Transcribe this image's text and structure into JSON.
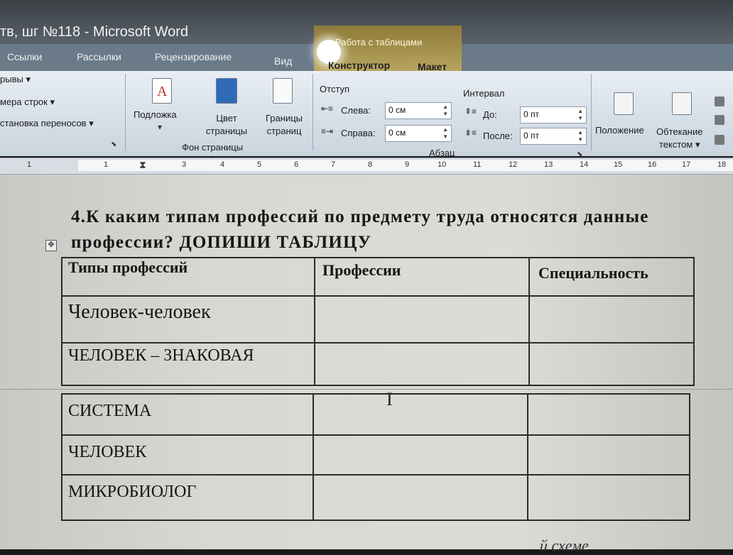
{
  "window": {
    "title": "тв, шг №118  -  Microsoft Word"
  },
  "context_group": {
    "title": "Работа с таблицами",
    "tabs": [
      "Конструктор",
      "Макет"
    ]
  },
  "tabs": [
    "Ссылки",
    "Рассылки",
    "Рецензирование",
    "Вид"
  ],
  "ribbon": {
    "left_items": [
      "рывы",
      "мера строк",
      "становка переносов"
    ],
    "background": {
      "watermark": "Подложка",
      "page_color": "Цвет страницы",
      "page_borders": "Границы страниц",
      "group": "Фон страницы"
    },
    "paragraph": {
      "indent_label": "Отступ",
      "left_label": "Слева:",
      "left_value": "0 см",
      "right_label": "Справа:",
      "right_value": "0 см",
      "spacing_label": "Интервал",
      "before_label": "До:",
      "before_value": "0 пт",
      "after_label": "После:",
      "after_value": "0 пт",
      "group": "Абзац"
    },
    "arrange": {
      "position": "Положение",
      "wrap": "Обтекание",
      "wrap2": "текстом"
    }
  },
  "ruler": {
    "numbers": [
      "1",
      "1",
      "3",
      "4",
      "5",
      "6",
      "7",
      "8",
      "9",
      "10",
      "11",
      "12",
      "13",
      "14",
      "15",
      "16",
      "17",
      "18"
    ]
  },
  "document": {
    "question_line1": "4.К каким типам профессий по предмету труда относятся данные",
    "question_line2": "профессии? ДОПИШИ ТАБЛИЦУ",
    "table": {
      "headers": [
        "Типы профессий",
        "Профессии",
        "Специальность"
      ],
      "rows": [
        "Человек-человек",
        "ЧЕЛОВЕК – ЗНАКОВАЯ",
        "СИСТЕМА",
        "ЧЕЛОВЕК",
        "МИКРОБИОЛОГ"
      ]
    },
    "bottom_text": "й схеме"
  }
}
